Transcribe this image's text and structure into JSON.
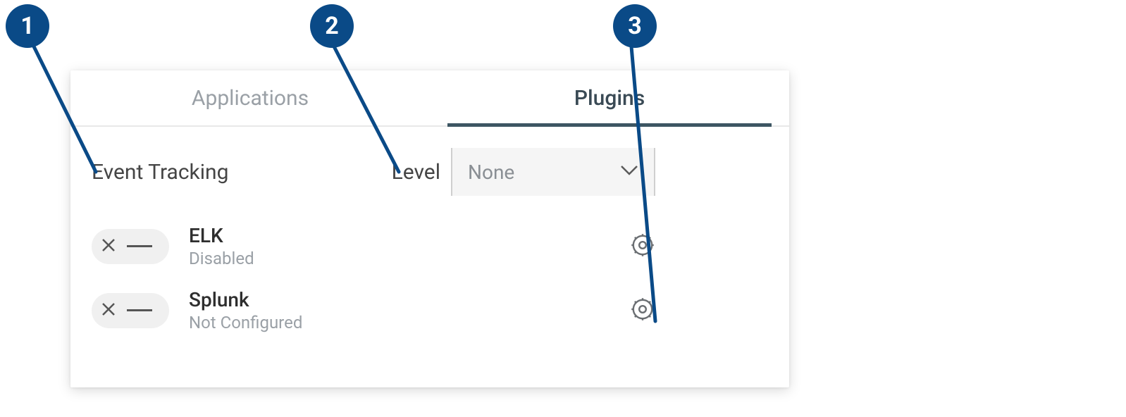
{
  "tabs": {
    "applications": "Applications",
    "plugins": "Plugins"
  },
  "section": {
    "title": "Event Tracking",
    "level_label": "Level",
    "level_value": "None"
  },
  "plugins": [
    {
      "name": "ELK",
      "status": "Disabled"
    },
    {
      "name": "Splunk",
      "status": "Not Configured"
    }
  ],
  "callouts": {
    "one": "1",
    "two": "2",
    "three": "3"
  }
}
